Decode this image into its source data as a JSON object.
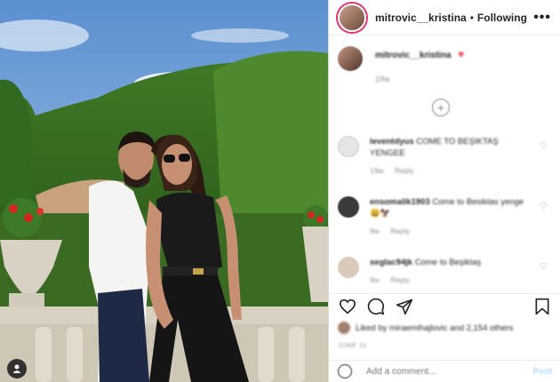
{
  "header": {
    "username": "mitrovic__kristina",
    "separator": "•",
    "follow_status": "Following",
    "more_label": "•••"
  },
  "caption": {
    "username": "mitrovic__kristina",
    "emoji": "♥",
    "time": "19w"
  },
  "load_more": {
    "label": "+"
  },
  "comments": [
    {
      "username": "leventdyus",
      "text": "COME TO BEŞIKTAŞ YENGEE",
      "meta": [
        "19w",
        "Reply"
      ],
      "avatar_color": "#e5e5e5"
    },
    {
      "username": "ensomalik1903",
      "text": "Come to Besiktas yenge 😃🦅",
      "meta": [
        "9w",
        "Reply"
      ],
      "avatar_color": "#3a3a3a"
    },
    {
      "username": "seglac94jk",
      "text": "Come to Beşiktaş",
      "meta": [
        "9w",
        "Reply"
      ],
      "avatar_color": "#d9c9b8"
    }
  ],
  "likes": {
    "text": "Liked by miraemihajlovic and 2,154 others"
  },
  "post_date": "JUNE 11",
  "add_comment": {
    "placeholder": "Add a comment...",
    "post_label": "Post"
  },
  "colors": {
    "accent": "#0095f6",
    "heart": "#ed4956",
    "border": "#dbdbdb"
  }
}
